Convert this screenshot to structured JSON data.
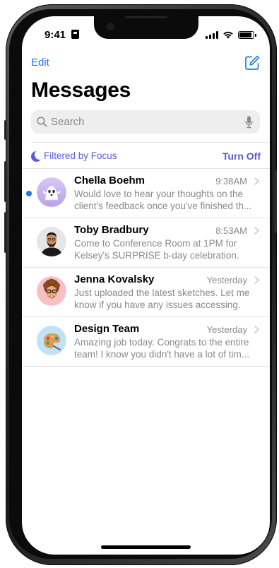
{
  "status_bar": {
    "time": "9:41"
  },
  "nav": {
    "edit_label": "Edit"
  },
  "title": "Messages",
  "search": {
    "placeholder": "Search"
  },
  "focus_filter": {
    "label": "Filtered by Focus",
    "action": "Turn Off",
    "accent_color": "#5b5bd6"
  },
  "conversations": [
    {
      "name": "Chella Boehm",
      "time": "9:38AM",
      "preview": "Would love to hear your thoughts on the client's feedback once you've finished th...",
      "unread": true,
      "avatar": "ghost-memoji-avatar"
    },
    {
      "name": "Toby Bradbury",
      "time": "8:53AM",
      "preview": "Come to Conference Room at 1PM for Kelsey's SURPRISE b-day celebration.",
      "unread": false,
      "avatar": "photo-avatar"
    },
    {
      "name": "Jenna Kovalsky",
      "time": "Yesterday",
      "preview": "Just uploaded the latest sketches. Let me know if you have any issues accessing.",
      "unread": false,
      "avatar": "memoji-avatar"
    },
    {
      "name": "Design Team",
      "time": "Yesterday",
      "preview": "Amazing job today. Congrats to the entire team! I know you didn't have a lot of tim...",
      "unread": false,
      "avatar": "palette-avatar"
    }
  ],
  "colors": {
    "link_blue": "#1f7ae0",
    "secondary_text": "#8a8a8e",
    "search_bg": "#eeeeef"
  }
}
